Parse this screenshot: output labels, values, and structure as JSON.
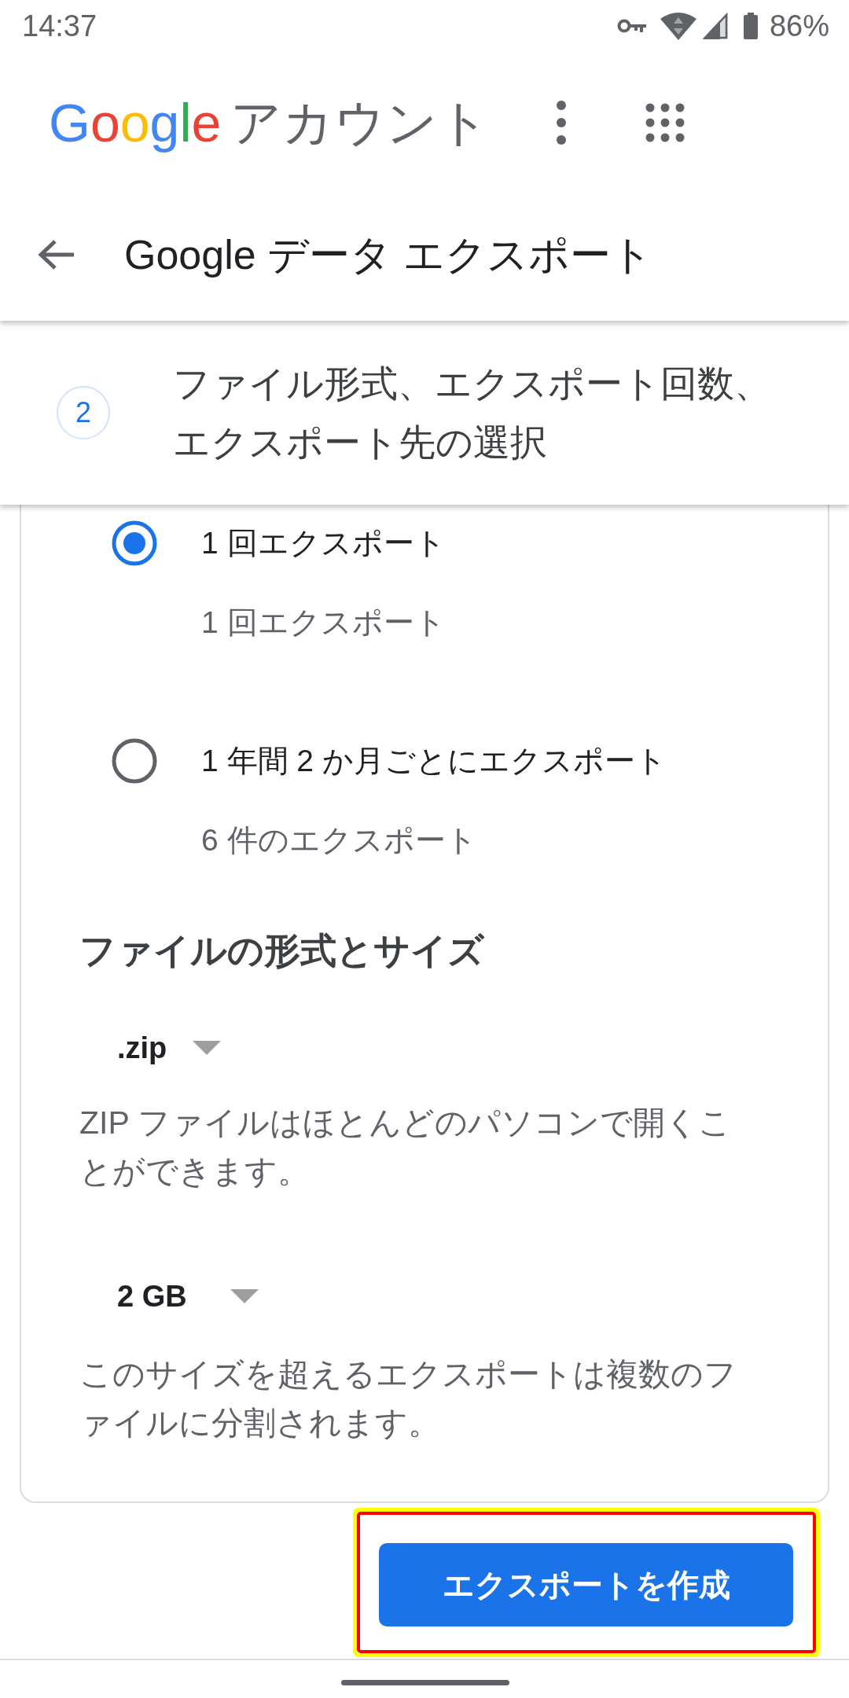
{
  "status_bar": {
    "time": "14:37",
    "battery": "86%"
  },
  "app_bar": {
    "logo": "Google",
    "title": "アカウント"
  },
  "toolbar": {
    "title": "Google データ エクスポート"
  },
  "step": {
    "number": "2",
    "title": "ファイル形式、エクスポート回数、エクスポート先の選択"
  },
  "frequency": {
    "options": [
      {
        "label": "1 回エクスポート",
        "detail": "1 回エクスポート",
        "selected": true
      },
      {
        "label": "1 年間 2 か月ごとにエクスポート",
        "detail": "6 件のエクスポート",
        "selected": false
      }
    ]
  },
  "file_format_size": {
    "heading": "ファイルの形式とサイズ",
    "file_type": {
      "value": ".zip",
      "description": "ZIP ファイルはほとんどのパソコンで開くことができます。"
    },
    "file_size": {
      "value": "2 GB",
      "description": "このサイズを超えるエクスポートは複数のファイルに分割されます。"
    }
  },
  "create_button": {
    "label": "エクスポートを作成",
    "highlighted": true
  }
}
